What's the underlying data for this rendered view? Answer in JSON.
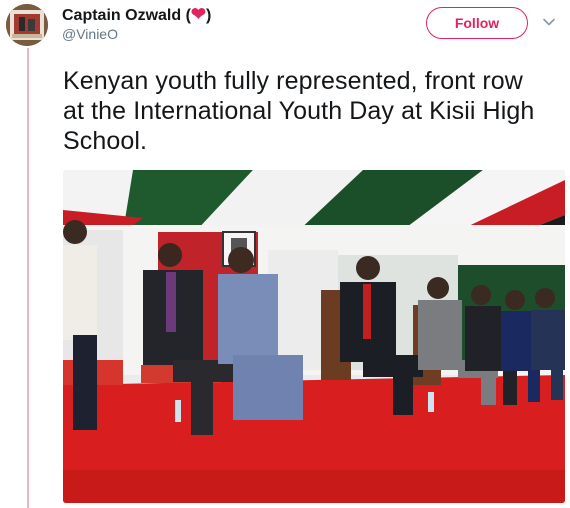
{
  "tweet": {
    "display_name": "Captain Ozwald (",
    "display_name_suffix": ")",
    "heart_glyph": "❤",
    "handle": "@VinieO",
    "follow_label": "Follow",
    "text": "Kenyan youth fully represented, front row at the International Youth Day at Kisii High School.",
    "photo_icon": "event-photo"
  },
  "colors": {
    "accent": "#e0245e",
    "thread_line": "#f2b2be",
    "text": "#14171a",
    "muted": "#657786",
    "carpet_red": "#d81e1e",
    "tent_green": "#1f5a2e"
  }
}
